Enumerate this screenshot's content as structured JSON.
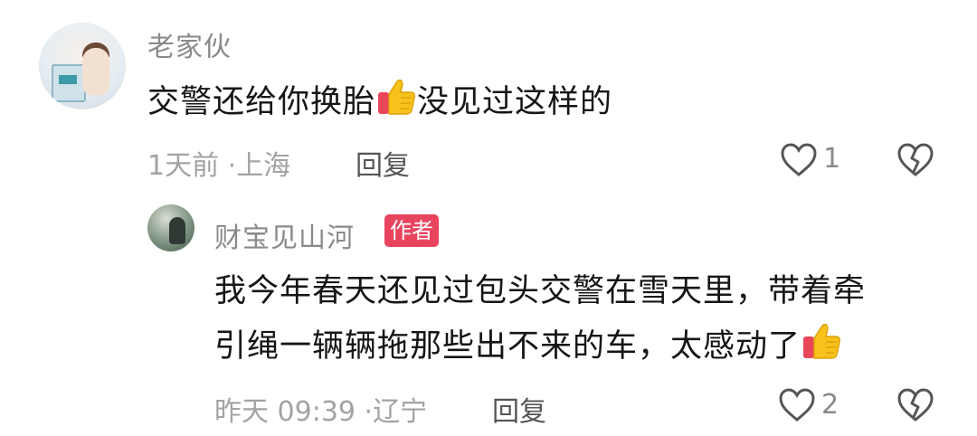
{
  "comment": {
    "username": "老家伙",
    "text_before_emoji": "交警还给你换胎",
    "emoji_name": "thumbs-up",
    "text_after_emoji": "没见过这样的",
    "time": "1天前",
    "separator": "·",
    "location": "上海",
    "reply_label": "回复",
    "like_count": "1"
  },
  "reply": {
    "username": "财宝见山河",
    "badge": "作者",
    "line1": "我今年春天还见过包头交警在雪天里，带着牵",
    "line2": "引绳一辆辆拖那些出不来的车，太感动了",
    "emoji_name": "thumbs-up",
    "time": "昨天 09:39",
    "separator": "·",
    "location": "辽宁",
    "reply_label": "回复",
    "like_count": "2"
  },
  "icons": {
    "like": "heart-outline-icon",
    "dislike": "broken-heart-icon"
  },
  "colors": {
    "author_badge": "#e8445e",
    "thumb_yellow": "#f6c21b",
    "thumb_red": "#e9465a"
  }
}
